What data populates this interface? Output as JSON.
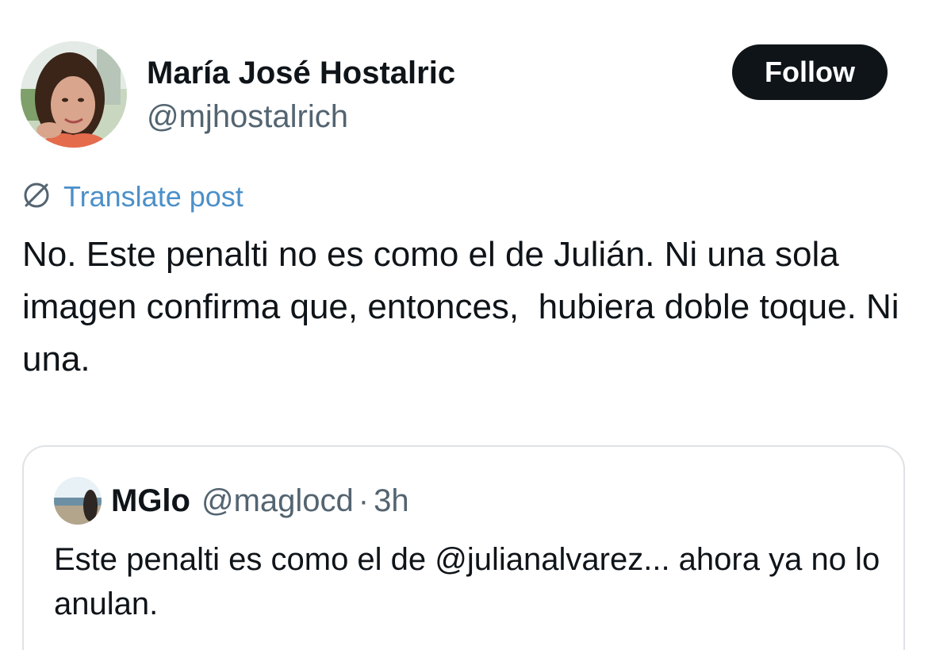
{
  "author": {
    "display_name": "María José Hostalric",
    "handle": "@mjhostalrich",
    "avatar_icon": "profile-photo"
  },
  "follow_button": {
    "label": "Follow"
  },
  "translate": {
    "label": "Translate post",
    "icon": "translate-globe-icon",
    "color": "#4b90c9"
  },
  "post": {
    "text": "No. Este penalti no es como el de Julián. Ni una sola imagen confirma que, entonces,  hubiera doble toque. Ni una."
  },
  "quoted_post": {
    "display_name": "MGlo",
    "handle": "@maglocd",
    "separator": "·",
    "time": "3h",
    "text": "Este penalti es como el de @julianalvarez... ahora ya no lo anulan."
  },
  "colors": {
    "text_primary": "#0f1419",
    "text_secondary": "#536471",
    "follow_bg": "#0f1419",
    "border": "#dfe3e6"
  }
}
